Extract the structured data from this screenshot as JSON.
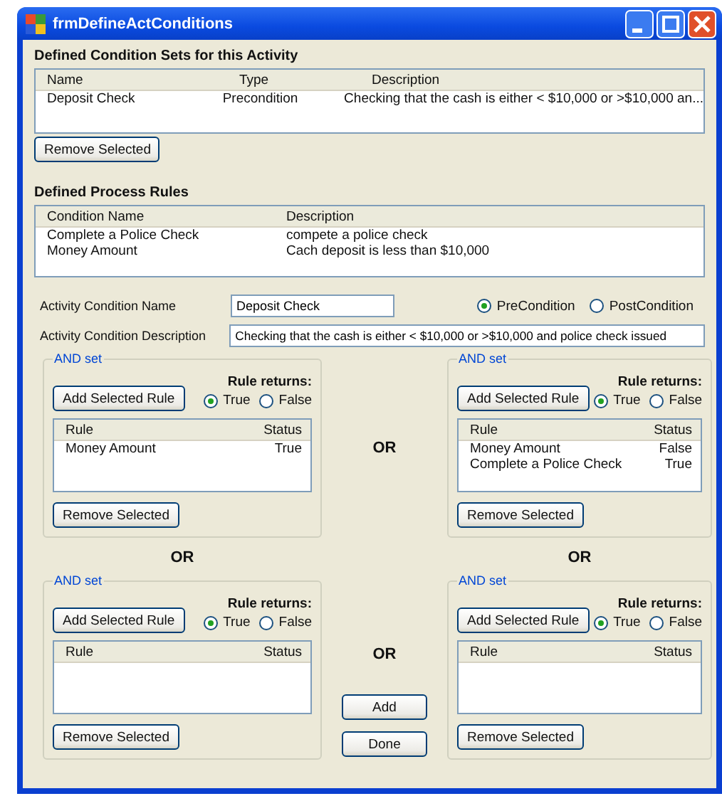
{
  "window": {
    "title": "frmDefineActConditions"
  },
  "condition_sets": {
    "heading": "Defined Condition Sets for this Activity",
    "columns": [
      "Name",
      "Type",
      "Description"
    ],
    "rows": [
      [
        "Deposit Check",
        "Precondition",
        "Checking that the cash is either < $10,000 or >$10,000 an..."
      ]
    ],
    "remove_button": "Remove Selected"
  },
  "process_rules": {
    "heading": "Defined Process Rules",
    "columns": [
      "Condition Name",
      "Description"
    ],
    "rows": [
      [
        "Complete a Police Check",
        "compete a police check"
      ],
      [
        "Money Amount",
        "Cach deposit is less than $10,000"
      ]
    ]
  },
  "activity_condition_name": {
    "label": "Activity Condition Name",
    "value": "Deposit Check"
  },
  "condition_type": [
    {
      "label": "PreCondition",
      "selected": true
    },
    {
      "label": "PostCondition",
      "selected": false
    }
  ],
  "activity_condition_description": {
    "label": "Activity Condition Description",
    "value": "Checking that the cash is either < $10,000 or >$10,000 and police check issued"
  },
  "and_sets": [
    {
      "legend": "AND set",
      "add_button": "Add Selected Rule",
      "rule_returns_label": "Rule returns:",
      "returns": [
        {
          "label": "True",
          "selected": true
        },
        {
          "label": "False",
          "selected": false
        }
      ],
      "columns": [
        "Rule",
        "Status"
      ],
      "rows": [
        [
          "Money Amount",
          "True"
        ]
      ],
      "remove_button": "Remove Selected"
    },
    {
      "legend": "AND set",
      "add_button": "Add Selected Rule",
      "rule_returns_label": "Rule returns:",
      "returns": [
        {
          "label": "True",
          "selected": true
        },
        {
          "label": "False",
          "selected": false
        }
      ],
      "columns": [
        "Rule",
        "Status"
      ],
      "rows": [
        [
          "Money Amount",
          "False"
        ],
        [
          "Complete a Police Check",
          "True"
        ]
      ],
      "remove_button": "Remove Selected"
    },
    {
      "legend": "AND set",
      "add_button": "Add Selected Rule",
      "rule_returns_label": "Rule returns:",
      "returns": [
        {
          "label": "True",
          "selected": true
        },
        {
          "label": "False",
          "selected": false
        }
      ],
      "columns": [
        "Rule",
        "Status"
      ],
      "remove_button": "Remove Selected"
    },
    {
      "legend": "AND set",
      "add_button": "Add Selected Rule",
      "rule_returns_label": "Rule returns:",
      "returns": [
        {
          "label": "True",
          "selected": true
        },
        {
          "label": "False",
          "selected": false
        }
      ],
      "columns": [
        "Rule",
        "Status"
      ],
      "remove_button": "Remove Selected"
    }
  ],
  "or_labels": [
    "OR",
    "OR",
    "OR",
    "OR"
  ],
  "buttons": [
    "Add",
    "Done"
  ]
}
